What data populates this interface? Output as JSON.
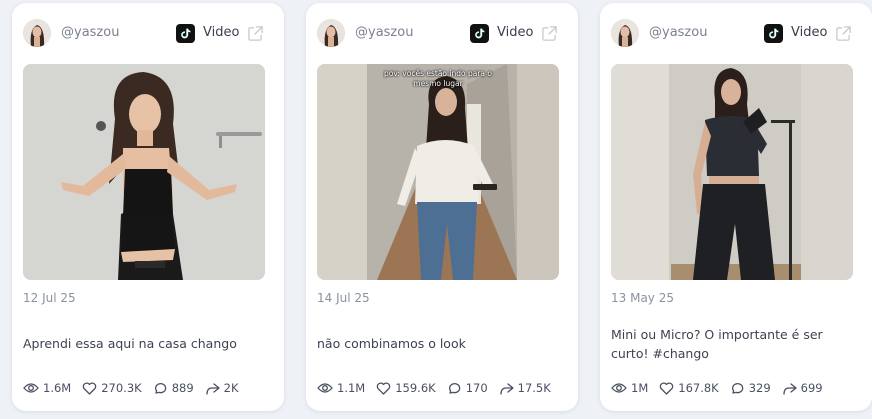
{
  "cards": [
    {
      "username": "@yaszou",
      "platform_label": "Video",
      "date": "12 Jul 25",
      "caption": "Aprendi essa aqui na casa chango",
      "overlay_text": "",
      "stats": {
        "views": "1.6M",
        "likes": "270.3K",
        "comments": "889",
        "shares": "2K"
      }
    },
    {
      "username": "@yaszou",
      "platform_label": "Video",
      "date": "14 Jul 25",
      "caption": "não combinamos o look",
      "overlay_text": "pov: vocês estão indo para o mesmo lugar",
      "stats": {
        "views": "1.1M",
        "likes": "159.6K",
        "comments": "170",
        "shares": "17.5K"
      }
    },
    {
      "username": "@yaszou",
      "platform_label": "Video",
      "date": "13 May 25",
      "caption": "Mini ou Micro? O importante é ser curto! #chango",
      "overlay_text": "",
      "stats": {
        "views": "1M",
        "likes": "167.8K",
        "comments": "329",
        "shares": "699"
      }
    }
  ],
  "icons": [
    "eye-icon",
    "heart-icon",
    "comment-icon",
    "share-icon",
    "tiktok-icon",
    "external-link-icon"
  ],
  "colors": {
    "background": "#eef1f6",
    "card": "#ffffff",
    "muted_text": "#8a92a2"
  }
}
